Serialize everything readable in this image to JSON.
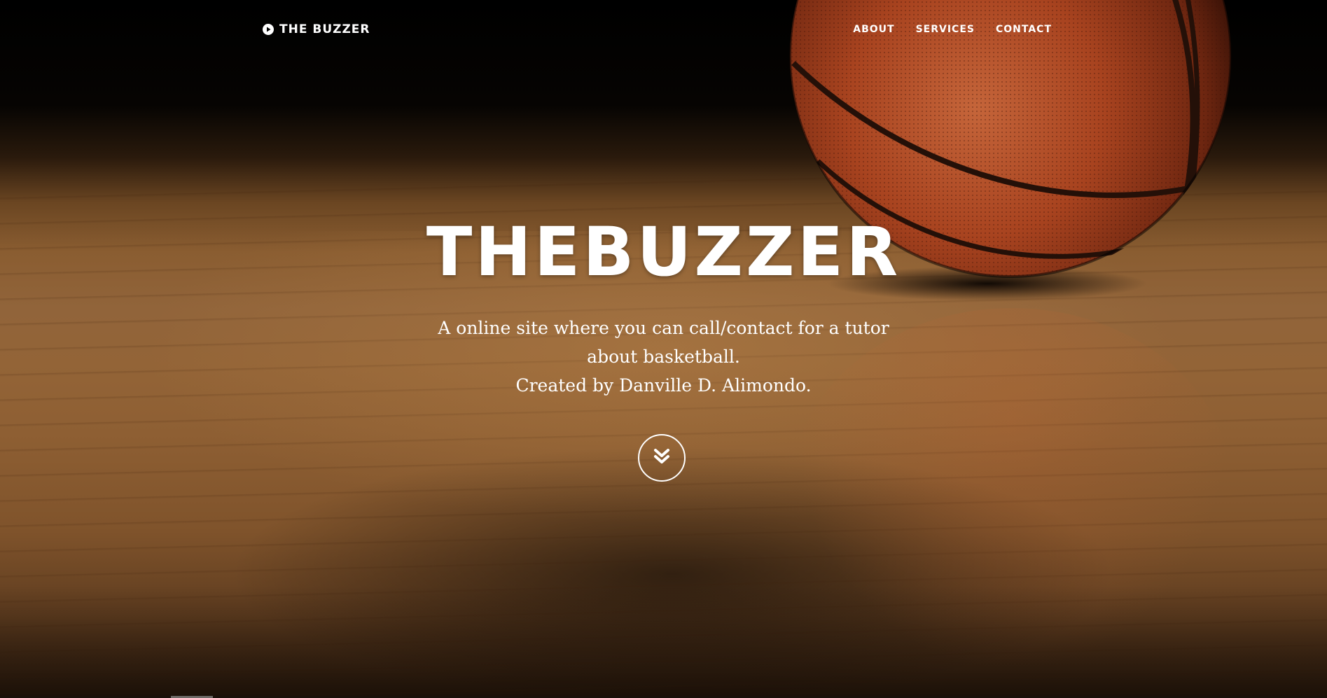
{
  "navbar": {
    "brand": "THE BUZZER",
    "brand_icon": "play-circle-icon",
    "links": [
      {
        "label": "ABOUT"
      },
      {
        "label": "SERVICES"
      },
      {
        "label": "CONTACT"
      }
    ]
  },
  "intro": {
    "title": "THEBUZZER",
    "text_line1": "A online site where you can call/contact for a tutor about basketball.",
    "text_line2": "Created by Danville D. Alimondo.",
    "scroll_icon": "double-chevron-down-icon"
  },
  "colors": {
    "text": "#ffffff",
    "floor": "#8e5f33",
    "ball": "#a8431f",
    "background_top": "#000000"
  }
}
